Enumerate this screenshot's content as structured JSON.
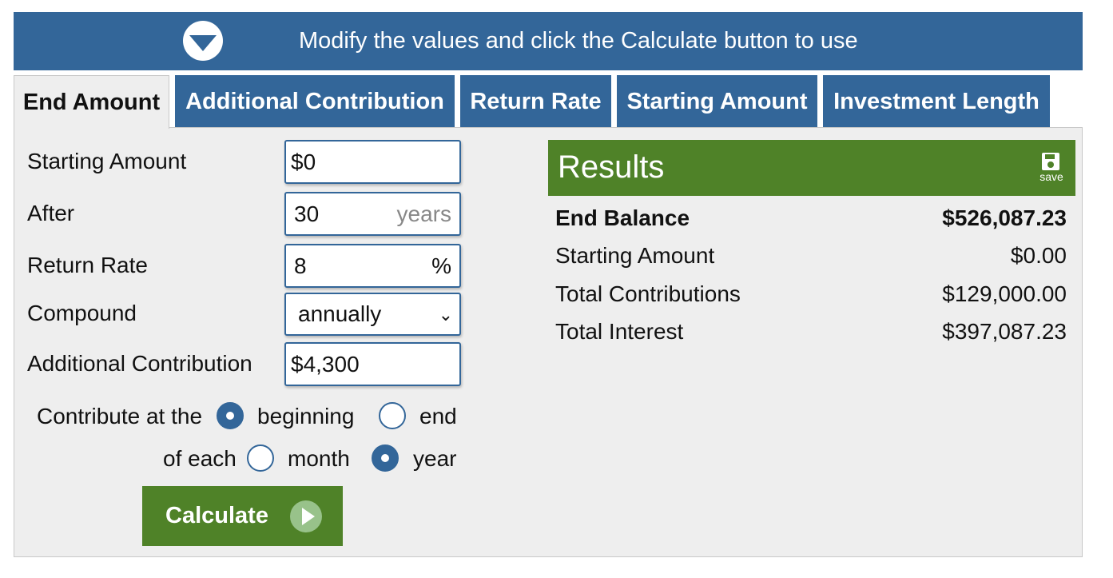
{
  "banner": {
    "message": "Modify the values and click the Calculate button to use"
  },
  "tabs": [
    {
      "label": "End Amount",
      "active": true
    },
    {
      "label": "Additional Contribution",
      "active": false
    },
    {
      "label": "Return Rate",
      "active": false
    },
    {
      "label": "Starting Amount",
      "active": false
    },
    {
      "label": "Investment Length",
      "active": false
    }
  ],
  "form": {
    "starting_amount": {
      "label": "Starting Amount",
      "value": "$0"
    },
    "after": {
      "label": "After",
      "value": "30",
      "unit": "years"
    },
    "return_rate": {
      "label": "Return Rate",
      "value": "8",
      "unit": "%"
    },
    "compound": {
      "label": "Compound",
      "value": "annually"
    },
    "additional_contribution": {
      "label": "Additional Contribution",
      "value": "$4,300"
    },
    "contribute_at": {
      "prefix": "Contribute at the",
      "option1": "beginning",
      "option2": "end",
      "selected": "beginning"
    },
    "of_each": {
      "prefix": "of each",
      "option1": "month",
      "option2": "year",
      "selected": "year"
    },
    "calculate_label": "Calculate"
  },
  "results": {
    "title": "Results",
    "save_label": "save",
    "rows": [
      {
        "label": "End Balance",
        "value": "$526,087.23",
        "bold": true
      },
      {
        "label": "Starting Amount",
        "value": "$0.00",
        "bold": false
      },
      {
        "label": "Total Contributions",
        "value": "$129,000.00",
        "bold": false
      },
      {
        "label": "Total Interest",
        "value": "$397,087.23",
        "bold": false
      }
    ]
  },
  "colors": {
    "blue": "#336699",
    "green": "#4f8228",
    "panel": "#eeeeee"
  }
}
